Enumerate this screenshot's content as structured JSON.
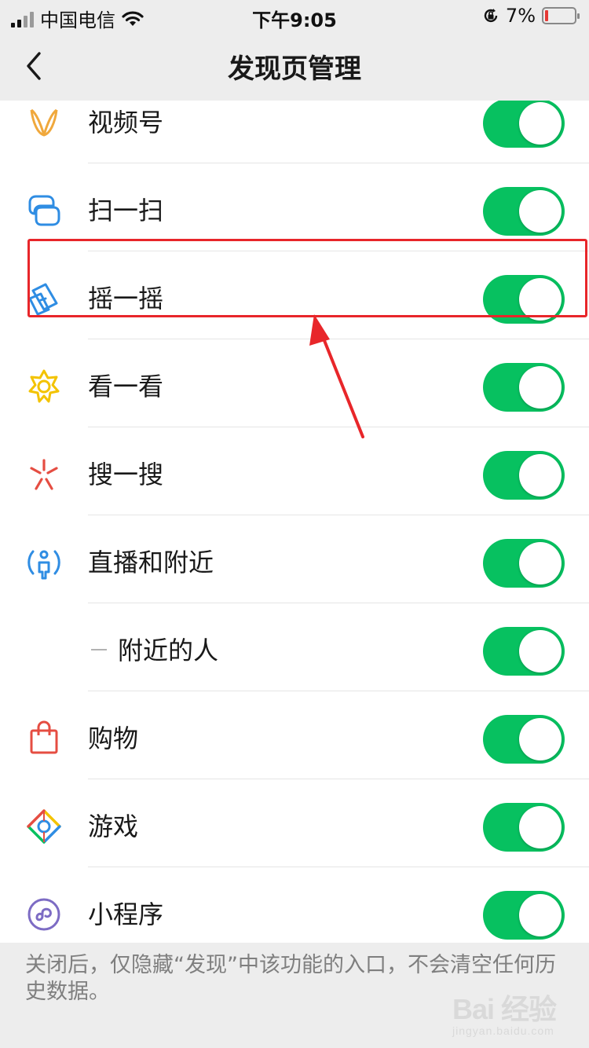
{
  "status_bar": {
    "carrier": "中国电信",
    "time": "下午9:05",
    "battery": "7%",
    "battery_level": 0.07,
    "icons": [
      "signal-icon",
      "wifi-icon",
      "orientation-lock-icon",
      "battery-icon"
    ]
  },
  "nav": {
    "title": "发现页管理",
    "back_icon": "chevron-left-icon"
  },
  "accent_color": "#07c160",
  "items": [
    {
      "label": "视频号",
      "icon": "channels-icon",
      "enabled": true
    },
    {
      "label": "扫一扫",
      "icon": "scan-icon",
      "enabled": true
    },
    {
      "label": "摇一摇",
      "icon": "shake-icon",
      "enabled": true
    },
    {
      "label": "看一看",
      "icon": "top-stories-icon",
      "enabled": true
    },
    {
      "label": "搜一搜",
      "icon": "search-icon",
      "enabled": true
    },
    {
      "label": "直播和附近",
      "icon": "live-nearby-icon",
      "enabled": true
    },
    {
      "label": "附近的人",
      "icon": "sub-item-dash",
      "enabled": true
    },
    {
      "label": "购物",
      "icon": "shopping-bag-icon",
      "enabled": true
    },
    {
      "label": "游戏",
      "icon": "games-icon",
      "enabled": true
    },
    {
      "label": "小程序",
      "icon": "mini-programs-icon",
      "enabled": true
    }
  ],
  "footer": {
    "note": "关闭后，仅隐藏“发现”中该功能的入口，不会清空任何历史数据。"
  },
  "watermark": {
    "main": "Bai 经验",
    "sub": "jingyan.baidu.com"
  }
}
